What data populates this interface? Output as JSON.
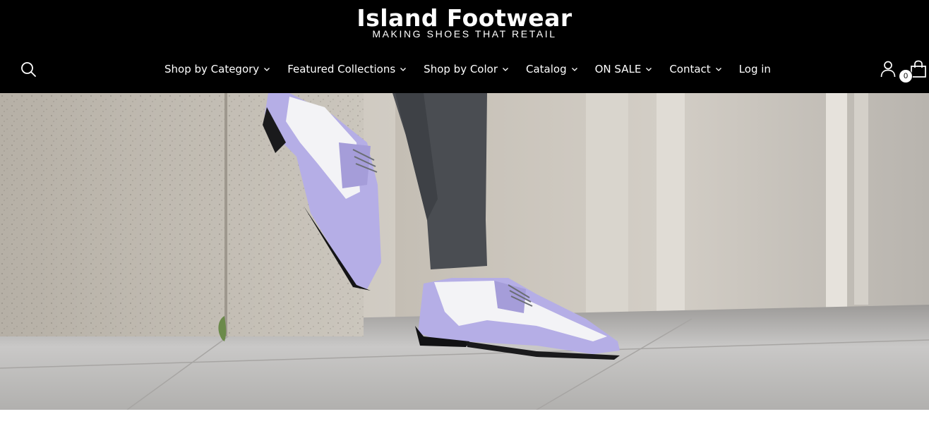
{
  "header": {
    "logo_title": "Island Footwear",
    "logo_tagline": "MAKING SHOES THAT RETAIL",
    "background": "#000000"
  },
  "nav": {
    "items": [
      {
        "label": "Shop by Category",
        "dropdown": true
      },
      {
        "label": "Featured Collections",
        "dropdown": true
      },
      {
        "label": "Shop by Color",
        "dropdown": true
      },
      {
        "label": "Catalog",
        "dropdown": true
      },
      {
        "label": "ON SALE",
        "dropdown": true
      },
      {
        "label": "Contact",
        "dropdown": true
      },
      {
        "label": "Log in",
        "dropdown": false
      }
    ]
  },
  "icons": {
    "search": "search-icon",
    "account": "user-icon",
    "cart": "shopping-bag-icon",
    "chevron": "chevron-down-icon"
  },
  "cart": {
    "count": "0"
  },
  "hero": {
    "description_colors": {
      "shoe_accent": "#b5aee6",
      "shoe_white": "#f3f3f6",
      "pants": "#4a4d52"
    }
  }
}
